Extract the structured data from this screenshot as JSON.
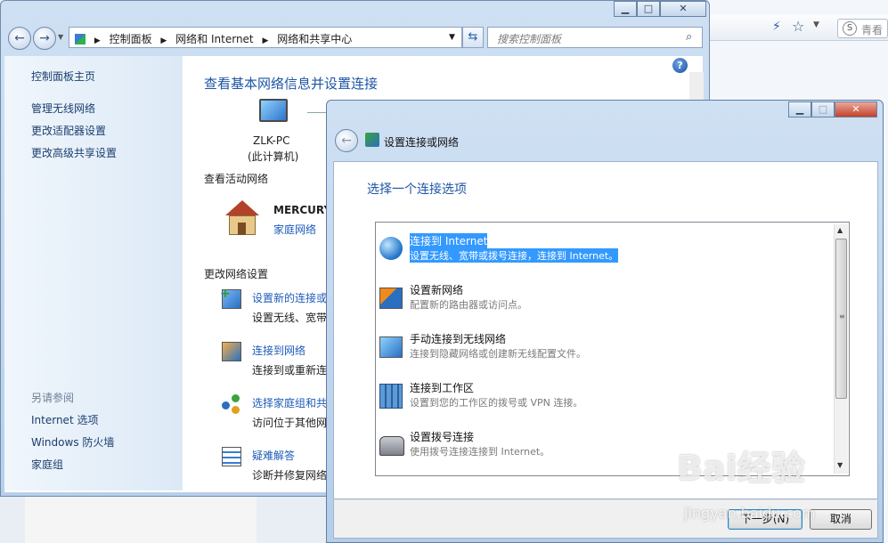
{
  "browser": {
    "search_placeholder": "青看"
  },
  "main_window": {
    "address_root": "控制面板",
    "address_mid": "网络和 Internet",
    "address_leaf": "网络和共享中心",
    "search_placeholder": "搜索控制面板",
    "sidebar": {
      "home": "控制面板主页",
      "links": [
        "管理无线网络",
        "更改适配器设置",
        "更改高级共享设置"
      ],
      "see_also_title": "另请参阅",
      "see_also": [
        "Internet 选项",
        "Windows 防火墙",
        "家庭组"
      ]
    },
    "title": "查看基本网络信息并设置连接",
    "computer_name": "ZLK-PC",
    "computer_sub": "(此计算机)",
    "active_networks_title": "查看活动网络",
    "network_name": "MERCURY",
    "network_type": "家庭网络",
    "change_settings_title": "更改网络设置",
    "tasks": [
      {
        "link": "设置新的连接或",
        "desc": "设置无线、宽带"
      },
      {
        "link": "连接到网络",
        "desc": "连接到或重新连"
      },
      {
        "link": "选择家庭组和共",
        "desc": "访问位于其他网"
      },
      {
        "link": "疑难解答",
        "desc": "诊断并修复网络"
      }
    ]
  },
  "dialog": {
    "title": "设置连接或网络",
    "heading": "选择一个连接选项",
    "options": [
      {
        "title": "连接到 Internet",
        "desc": "设置无线、宽带或拨号连接，连接到 Internet。",
        "selected": true,
        "icon": "globe-icon"
      },
      {
        "title": "设置新网络",
        "desc": "配置新的路由器或访问点。",
        "selected": false,
        "icon": "new-network-icon"
      },
      {
        "title": "手动连接到无线网络",
        "desc": "连接到隐藏网络或创建新无线配置文件。",
        "selected": false,
        "icon": "wireless-icon"
      },
      {
        "title": "连接到工作区",
        "desc": "设置到您的工作区的拨号或 VPN 连接。",
        "selected": false,
        "icon": "workplace-icon"
      },
      {
        "title": "设置拨号连接",
        "desc": "使用拨号连接连接到 Internet。",
        "selected": false,
        "icon": "dialup-icon"
      }
    ],
    "next_button": "下一步(N)",
    "cancel_button": "取消"
  },
  "watermark": {
    "brand": "Bai经验",
    "url": "jingyan.baidu.com"
  }
}
